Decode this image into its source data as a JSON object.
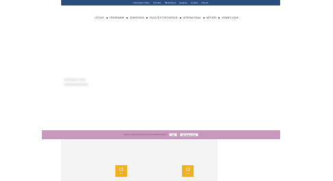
{
  "topbar": {
    "links": [
      "L'Ecosystem Mine",
      "Annuaire",
      "Bibliothèque",
      "Espaces",
      "Contact",
      "Intranet"
    ]
  },
  "mainnav": {
    "items": [
      "L'ÉCOLE",
      "PROGRAMME",
      "ADMISSIONS",
      "FACULTÉ ET RECHERCHE",
      "INTERNATIONAL",
      "MÉTIERS",
      "RENDEZ-VOUS"
    ]
  },
  "cookie_banner": {
    "ok_label": "Ok",
    "more_label": "En savoir plus"
  },
  "events": [
    {
      "day": "13"
    },
    {
      "day": "13"
    }
  ],
  "colors": {
    "topbar": "#2a4d7f",
    "cookie_banner": "#c996bd",
    "date_badge": "#f0b21c"
  }
}
